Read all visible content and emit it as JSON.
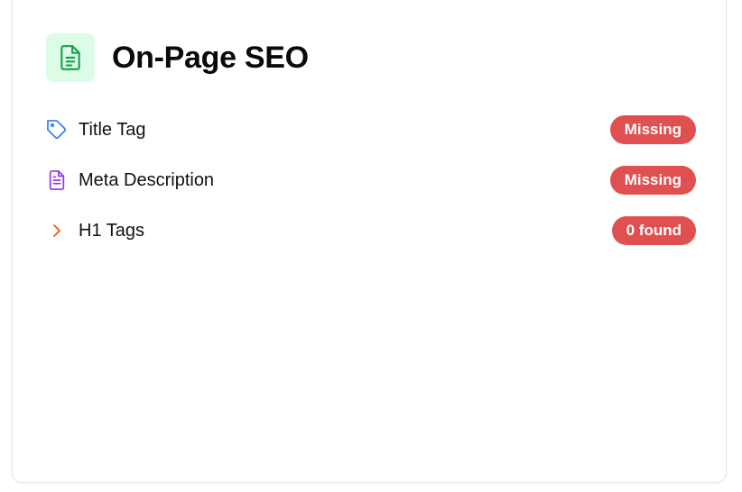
{
  "card": {
    "title": "On-Page SEO",
    "icon": "document-icon",
    "accent_color": "#16a34a"
  },
  "items": [
    {
      "label": "Title Tag",
      "icon": "tag-icon",
      "icon_color": "#3b82f6",
      "status": "Missing",
      "status_color": "#e05050"
    },
    {
      "label": "Meta Description",
      "icon": "document-icon",
      "icon_color": "#9333ea",
      "status": "Missing",
      "status_color": "#e05050"
    },
    {
      "label": "H1 Tags",
      "icon": "chevron-right-icon",
      "icon_color": "#ea580c",
      "status": "0 found",
      "status_color": "#e05050"
    }
  ]
}
